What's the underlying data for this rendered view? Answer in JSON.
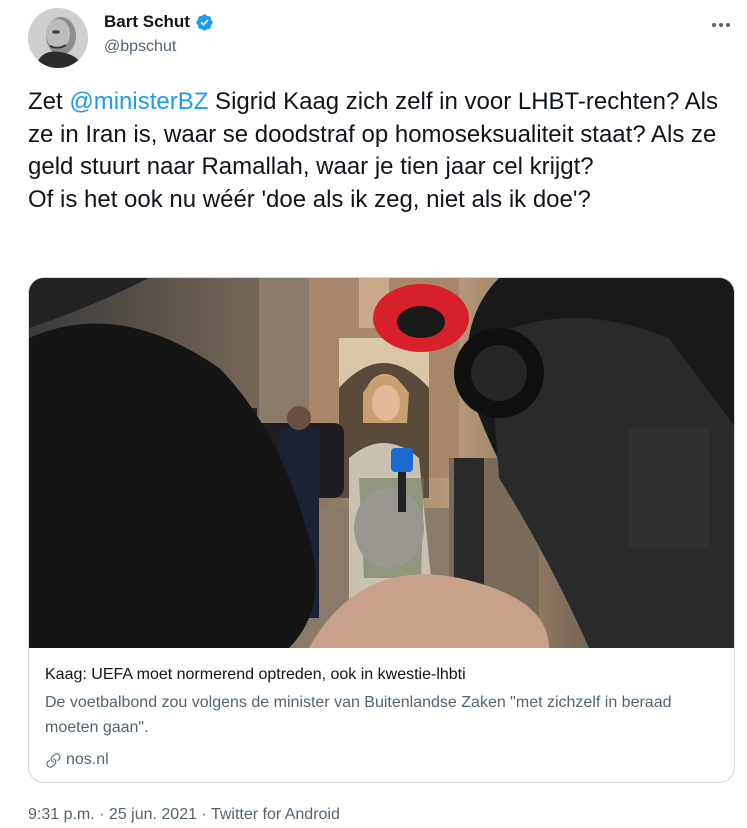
{
  "author": {
    "display_name": "Bart Schut",
    "handle": "@bpschut",
    "verified": true
  },
  "tweet": {
    "text_before_mention": "Zet ",
    "mention": "@ministerBZ",
    "text_after_mention": " Sigrid Kaag zich zelf in voor LHBT-rechten? Als ze in Iran is, waar se doodstraf op homoseksualiteit staat? Als ze geld stuurt naar Ramallah, waar je tien jaar cel krijgt?\nOf is het ook nu wéér 'doe als ik zeg, niet als ik doe'?"
  },
  "link_card": {
    "title": "Kaag: UEFA moet normerend optreden, ook in kwestie-lhbti",
    "description": "De voetbalbond zou volgens de minister van Buitenlandse Zaken \"met zichzelf in beraad moeten gaan\".",
    "domain": "nos.nl"
  },
  "meta": {
    "time": "9:31 p.m.",
    "separator_1": " · ",
    "date": "25 jun. 2021",
    "separator_2": " · ",
    "source": "Twitter for Android"
  },
  "icons": {
    "verified": "verified-badge-icon",
    "more": "more-options-icon",
    "link": "link-icon"
  },
  "colors": {
    "accent": "#1d9bf0",
    "text_primary": "#0f1419",
    "text_secondary": "#536471",
    "border": "#cfd9de"
  }
}
